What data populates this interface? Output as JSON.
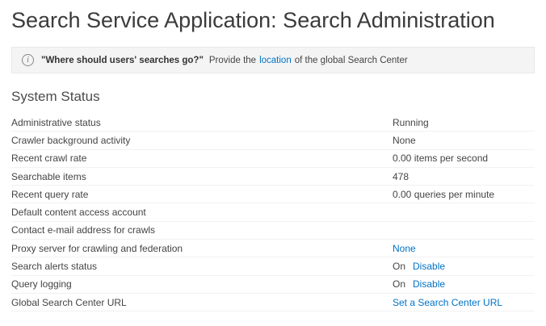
{
  "page": {
    "title": "Search Service Application: Search Administration"
  },
  "info_banner": {
    "icon": "info-icon",
    "bold_text": "\"Where should users' searches go?\"",
    "text_before_link": "Provide the",
    "link_text": "location",
    "text_after_link": "of the global Search Center"
  },
  "system_status": {
    "heading": "System Status",
    "rows": [
      {
        "label": "Administrative status",
        "value": "Running",
        "value_type": "text"
      },
      {
        "label": "Crawler background activity",
        "value": "None",
        "value_type": "text"
      },
      {
        "label": "Recent crawl rate",
        "value": "0.00 items per second",
        "value_type": "text"
      },
      {
        "label": "Searchable items",
        "value": "478",
        "value_type": "text"
      },
      {
        "label": "Recent query rate",
        "value": "0.00 queries per minute",
        "value_type": "text"
      },
      {
        "label": "Default content access account",
        "value": "",
        "value_type": "text"
      },
      {
        "label": "Contact e-mail address for crawls",
        "value": "",
        "value_type": "text"
      },
      {
        "label": "Proxy server for crawling and federation",
        "value": "None",
        "value_type": "link"
      },
      {
        "label": "Search alerts status",
        "value": "On",
        "action": "Disable",
        "value_type": "text_with_link"
      },
      {
        "label": "Query logging",
        "value": "On",
        "action": "Disable",
        "value_type": "text_with_link"
      },
      {
        "label": "Global Search Center URL",
        "value": "Set a Search Center URL",
        "value_type": "link"
      }
    ]
  },
  "colors": {
    "link": "#0072c6",
    "title": "#3b3b3b",
    "banner_bg": "#f4f4f4"
  }
}
